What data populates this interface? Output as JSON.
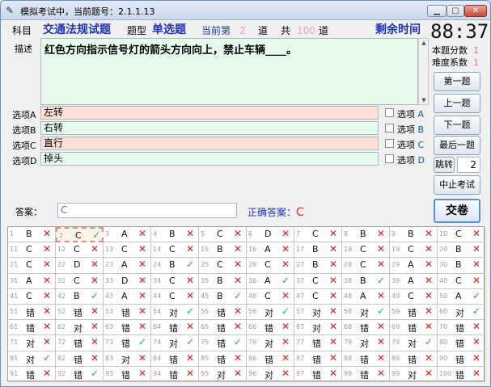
{
  "window": {
    "title": "模拟考试中，当前题号：2.1.1.13",
    "min": "▁",
    "max": "▢",
    "close": "✕"
  },
  "header": {
    "subject_label": "科目",
    "subject_value": "交通法规试题",
    "type_label": "题型",
    "type_value": "单选题",
    "current_label": "当前第",
    "current_value": "2",
    "unit1": "道",
    "total_label": "共",
    "total_value": "100",
    "unit2": "道",
    "remain_label": "剩余时间",
    "timer": "88:37"
  },
  "question": {
    "desc_label": "描述",
    "text": "红色方向指示信号灯的箭头方向向上，禁止车辆____。",
    "score_label": "本题分数",
    "score_value": "1",
    "difficulty_label": "难度系数",
    "difficulty_value": "1"
  },
  "options": [
    {
      "label": "选项A",
      "text": "左转",
      "chk_label": "选项",
      "letter": "A"
    },
    {
      "label": "选项B",
      "text": "右转",
      "chk_label": "选项",
      "letter": "B"
    },
    {
      "label": "选项C",
      "text": "直行",
      "chk_label": "选项",
      "letter": "C"
    },
    {
      "label": "选项D",
      "text": "掉头",
      "chk_label": "选项",
      "letter": "D"
    }
  ],
  "buttons": {
    "first": "第一题",
    "prev": "上一题",
    "next": "下一题",
    "last": "最后一题",
    "jump": "跳转",
    "jump_value": "2",
    "stop": "中止考试",
    "submit": "交卷"
  },
  "answer": {
    "label": "答案：",
    "value": "C",
    "correct_label": "正确答案：",
    "correct_value": "C"
  },
  "grid": {
    "current": 2,
    "items": [
      [
        "B",
        "x"
      ],
      [
        "C",
        "v"
      ],
      [
        "A",
        "x"
      ],
      [
        "B",
        "x"
      ],
      [
        "C",
        "x"
      ],
      [
        "D",
        "x"
      ],
      [
        "C",
        "x"
      ],
      [
        "B",
        "x"
      ],
      [
        "B",
        "x"
      ],
      [
        "C",
        "x"
      ],
      [
        "C",
        "x"
      ],
      [
        "C",
        "x"
      ],
      [
        "C",
        "x"
      ],
      [
        "C",
        "x"
      ],
      [
        "B",
        "x"
      ],
      [
        "A",
        "x"
      ],
      [
        "B",
        "x"
      ],
      [
        "C",
        "x"
      ],
      [
        "C",
        "x"
      ],
      [
        "B",
        "x"
      ],
      [
        "C",
        "x"
      ],
      [
        "D",
        "x"
      ],
      [
        "A",
        "x"
      ],
      [
        "B",
        "v"
      ],
      [
        "C",
        "x"
      ],
      [
        "C",
        "x"
      ],
      [
        "B",
        "x"
      ],
      [
        "C",
        "x"
      ],
      [
        "A",
        "x"
      ],
      [
        "B",
        "x"
      ],
      [
        "A",
        "x"
      ],
      [
        "C",
        "x"
      ],
      [
        "D",
        "x"
      ],
      [
        "C",
        "x"
      ],
      [
        "B",
        "x"
      ],
      [
        "A",
        "v"
      ],
      [
        "C",
        "x"
      ],
      [
        "B",
        "v"
      ],
      [
        "A",
        "x"
      ],
      [
        "C",
        "x"
      ],
      [
        "C",
        "x"
      ],
      [
        "B",
        "v"
      ],
      [
        "A",
        "x"
      ],
      [
        "C",
        "x"
      ],
      [
        "B",
        "v"
      ],
      [
        "C",
        "x"
      ],
      [
        "C",
        "x"
      ],
      [
        "A",
        "x"
      ],
      [
        "C",
        "x"
      ],
      [
        "A",
        "v"
      ],
      [
        "错",
        "x"
      ],
      [
        "错",
        "x"
      ],
      [
        "错",
        "x"
      ],
      [
        "对",
        "v"
      ],
      [
        "错",
        "x"
      ],
      [
        "对",
        "v"
      ],
      [
        "对",
        "x"
      ],
      [
        "对",
        "v"
      ],
      [
        "错",
        "x"
      ],
      [
        "对",
        "v"
      ],
      [
        "错",
        "x"
      ],
      [
        "对",
        "x"
      ],
      [
        "错",
        "x"
      ],
      [
        "错",
        "x"
      ],
      [
        "错",
        "x"
      ],
      [
        "错",
        "x"
      ],
      [
        "对",
        "x"
      ],
      [
        "错",
        "x"
      ],
      [
        "错",
        "x"
      ],
      [
        "错",
        "x"
      ],
      [
        "对",
        "x"
      ],
      [
        "错",
        "x"
      ],
      [
        "错",
        "v"
      ],
      [
        "对",
        "v"
      ],
      [
        "错",
        "v"
      ],
      [
        "对",
        "x"
      ],
      [
        "错",
        "x"
      ],
      [
        "对",
        "x"
      ],
      [
        "对",
        "v"
      ],
      [
        "错",
        "x"
      ],
      [
        "对",
        "v"
      ],
      [
        "错",
        "x"
      ],
      [
        "对",
        "x"
      ],
      [
        "错",
        "x"
      ],
      [
        "错",
        "x"
      ],
      [
        "错",
        "x"
      ],
      [
        "错",
        "x"
      ],
      [
        "错",
        "x"
      ],
      [
        "错",
        "x"
      ],
      [
        "错",
        "x"
      ],
      [
        "错",
        "x"
      ],
      [
        "错",
        "v"
      ],
      [
        "错",
        "x"
      ],
      [
        "错",
        "x"
      ],
      [
        "对",
        "x"
      ],
      [
        "对",
        "x"
      ],
      [
        "错",
        "x"
      ],
      [
        "错",
        "x"
      ],
      [
        "对",
        "x"
      ],
      [
        "错",
        "x"
      ]
    ]
  }
}
